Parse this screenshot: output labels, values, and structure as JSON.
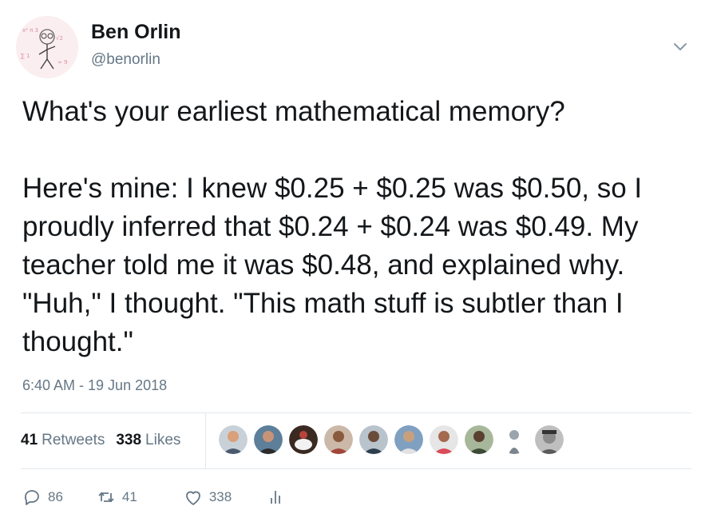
{
  "author": {
    "name": "Ben Orlin",
    "handle": "@benorlin",
    "avatar_icon": "stick-figure-doodle-avatar"
  },
  "tweet": {
    "text": "What's your earliest mathematical memory?\n\nHere's mine: I knew $0.25 + $0.25 was $0.50, so I proudly inferred that $0.24 + $0.24 was $0.49. My teacher told me it was $0.48, and explained why. \"Huh,\" I thought. \"This math stuff is subtler than I thought.\"",
    "timestamp": "6:40 AM - 19 Jun 2018"
  },
  "stats": {
    "retweets_count": "41",
    "retweets_label": "Retweets",
    "likes_count": "338",
    "likes_label": "Likes"
  },
  "actions": {
    "reply_count": "86",
    "retweet_count": "41",
    "like_count": "338"
  },
  "colors": {
    "text": "#14171a",
    "secondary": "#657786",
    "divider": "#e1e8ed"
  },
  "icons": [
    "chevron-down-icon",
    "reply-icon",
    "retweet-icon",
    "heart-icon",
    "analytics-icon"
  ],
  "liker_avatars_count": 9
}
